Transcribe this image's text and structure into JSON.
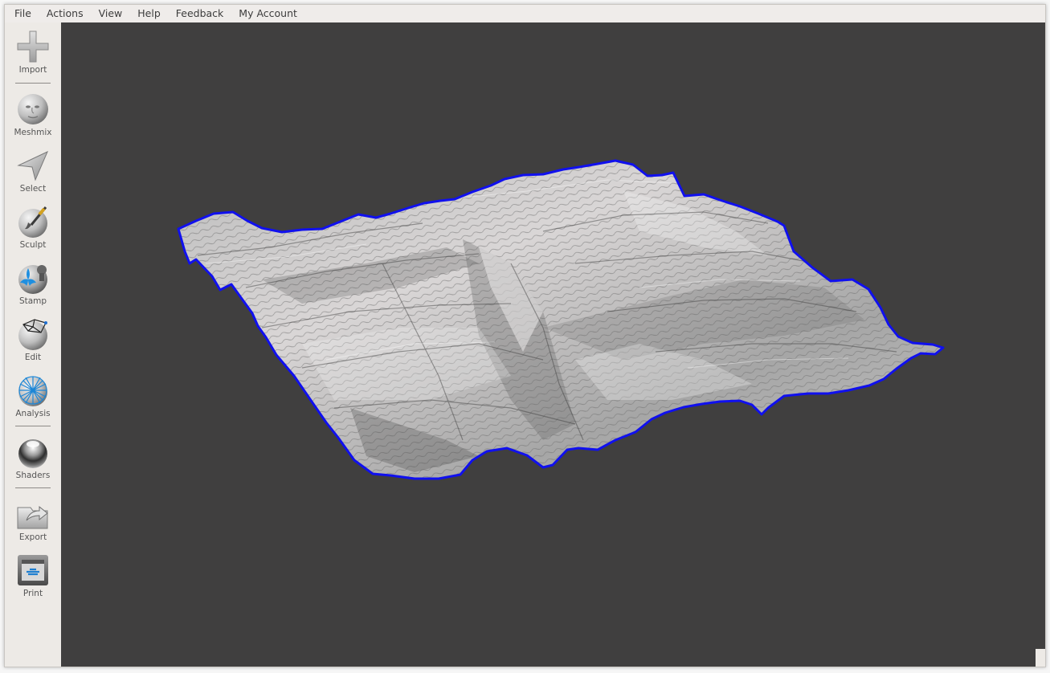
{
  "menubar": {
    "items": [
      "File",
      "Actions",
      "View",
      "Help",
      "Feedback",
      "My Account"
    ]
  },
  "toolbar": {
    "tools": [
      {
        "label": "Import",
        "icon": "plus-icon"
      },
      {
        "label": "Meshmix",
        "icon": "face-sphere-icon"
      },
      {
        "label": "Select",
        "icon": "arrow-cursor-icon"
      },
      {
        "label": "Sculpt",
        "icon": "brush-sphere-icon"
      },
      {
        "label": "Stamp",
        "icon": "fleur-stamp-icon"
      },
      {
        "label": "Edit",
        "icon": "mesh-edit-icon"
      },
      {
        "label": "Analysis",
        "icon": "wireframe-sphere-icon"
      },
      {
        "label": "Shaders",
        "icon": "chrome-sphere-icon"
      },
      {
        "label": "Export",
        "icon": "export-folder-icon"
      },
      {
        "label": "Print",
        "icon": "printer-icon"
      }
    ]
  },
  "viewport": {
    "content": "terrain-mesh",
    "background_color": "#403f3f",
    "selection_outline_color": "#1010ee",
    "mesh_color": "#c8c8c8"
  }
}
